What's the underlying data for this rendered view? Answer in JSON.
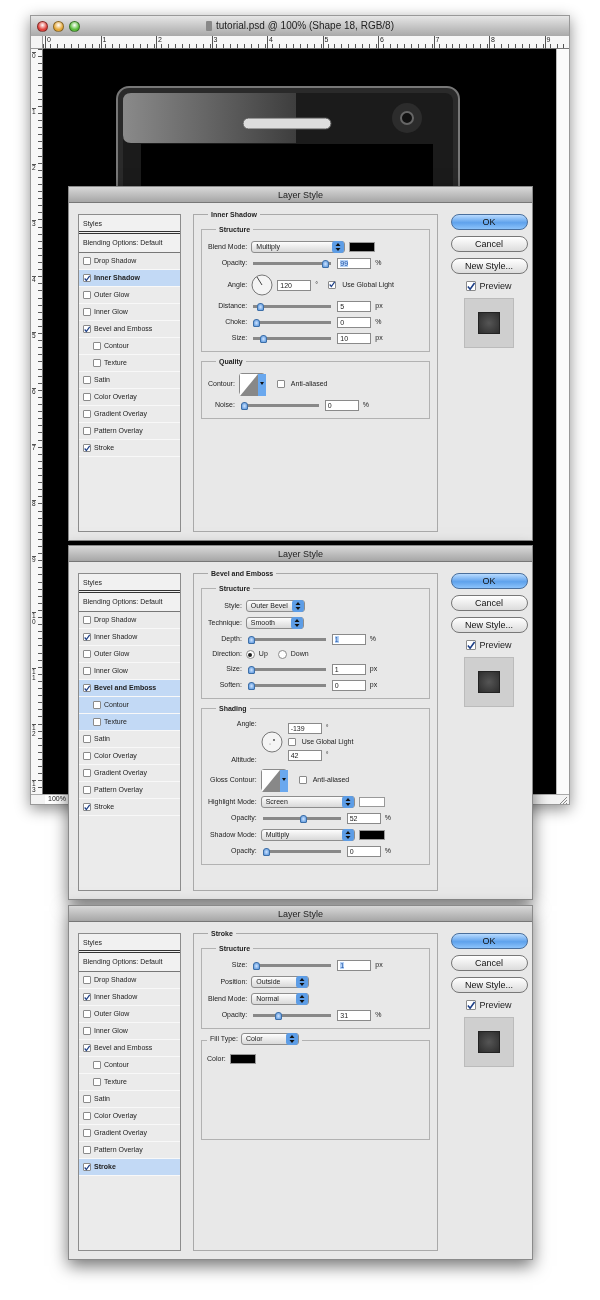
{
  "document_window": {
    "title": "tutorial.psd @ 100% (Shape 18, RGB/8)",
    "top_ruler": [
      "0",
      "1",
      "2",
      "3",
      "4",
      "5",
      "6",
      "7",
      "8",
      "9"
    ],
    "left_ruler": [
      "0",
      "1",
      "2",
      "3",
      "4",
      "5",
      "6",
      "7",
      "8",
      "9",
      "10",
      "11",
      "12",
      "13"
    ],
    "zoom": "100%"
  },
  "dialogs": [
    {
      "title": "Layer Style",
      "styles_header": "Styles",
      "blending_options": "Blending Options: Default",
      "styles": [
        {
          "label": "Drop Shadow",
          "checked": false,
          "selected": false
        },
        {
          "label": "Inner Shadow",
          "checked": true,
          "selected": true
        },
        {
          "label": "Outer Glow",
          "checked": false,
          "selected": false
        },
        {
          "label": "Inner Glow",
          "checked": false,
          "selected": false
        },
        {
          "label": "Bevel and Emboss",
          "checked": true,
          "selected": false,
          "children": [
            {
              "label": "Contour",
              "checked": false,
              "selected": false
            },
            {
              "label": "Texture",
              "checked": false,
              "selected": false
            }
          ]
        },
        {
          "label": "Satin",
          "checked": false,
          "selected": false
        },
        {
          "label": "Color Overlay",
          "checked": false,
          "selected": false
        },
        {
          "label": "Gradient Overlay",
          "checked": false,
          "selected": false
        },
        {
          "label": "Pattern Overlay",
          "checked": false,
          "selected": false
        },
        {
          "label": "Stroke",
          "checked": true,
          "selected": false
        }
      ],
      "panel": {
        "title": "Inner Shadow",
        "sections": [
          {
            "title": "Structure",
            "rows": [
              {
                "kind": "select",
                "label": "Blend Mode:",
                "value": "Multiply",
                "color": "#000000"
              },
              {
                "kind": "slider",
                "label": "Opacity:",
                "level": 0.97,
                "value": "99",
                "unit": "%",
                "focused": true
              },
              {
                "kind": "angle",
                "label": "Angle:",
                "value": "120",
                "unit": "°",
                "checkbox": {
                  "label": "Use Global Light",
                  "checked": true
                }
              },
              {
                "kind": "slider",
                "label": "Distance:",
                "level": 0.05,
                "value": "5",
                "unit": "px",
                "focused": false
              },
              {
                "kind": "slider",
                "label": "Choke:",
                "level": 0,
                "value": "0",
                "unit": "%",
                "focused": false
              },
              {
                "kind": "slider",
                "label": "Size:",
                "level": 0.1,
                "value": "10",
                "unit": "px",
                "focused": false
              }
            ]
          },
          {
            "title": "Quality",
            "rows": [
              {
                "kind": "contour",
                "label": "Contour:",
                "checkbox": {
                  "label": "Anti-aliased",
                  "checked": false
                }
              },
              {
                "kind": "slider",
                "label": "Noise:",
                "level": 0,
                "value": "0",
                "unit": "%",
                "focused": false
              }
            ]
          }
        ]
      },
      "buttons": [
        {
          "label": "OK",
          "kind": "default"
        },
        {
          "label": "Cancel",
          "kind": "normal"
        },
        {
          "label": "New Style...",
          "kind": "normal"
        }
      ],
      "preview": {
        "label": "Preview",
        "checked": true
      }
    },
    {
      "title": "Layer Style",
      "styles_header": "Styles",
      "blending_options": "Blending Options: Default",
      "styles": [
        {
          "label": "Drop Shadow",
          "checked": false,
          "selected": false
        },
        {
          "label": "Inner Shadow",
          "checked": true,
          "selected": false
        },
        {
          "label": "Outer Glow",
          "checked": false,
          "selected": false
        },
        {
          "label": "Inner Glow",
          "checked": false,
          "selected": false
        },
        {
          "label": "Bevel and Emboss",
          "checked": true,
          "selected": true,
          "children": [
            {
              "label": "Contour",
              "checked": false,
              "selected": true
            },
            {
              "label": "Texture",
              "checked": false,
              "selected": true
            }
          ]
        },
        {
          "label": "Satin",
          "checked": false,
          "selected": false
        },
        {
          "label": "Color Overlay",
          "checked": false,
          "selected": false
        },
        {
          "label": "Gradient Overlay",
          "checked": false,
          "selected": false
        },
        {
          "label": "Pattern Overlay",
          "checked": false,
          "selected": false
        },
        {
          "label": "Stroke",
          "checked": true,
          "selected": false
        }
      ],
      "panel": {
        "title": "Bevel and Emboss",
        "sections": [
          {
            "title": "Structure",
            "rows": [
              {
                "kind": "select",
                "label": "Style:",
                "value": "Outer Bevel"
              },
              {
                "kind": "select",
                "label": "Technique:",
                "value": "Smooth"
              },
              {
                "kind": "slider",
                "label": "Depth:",
                "level": 0,
                "value": "1",
                "unit": "%",
                "focused": true
              },
              {
                "kind": "radio",
                "label": "Direction:",
                "options": [
                  {
                    "label": "Up",
                    "selected": true
                  },
                  {
                    "label": "Down",
                    "selected": false
                  }
                ]
              },
              {
                "kind": "slider",
                "label": "Size:",
                "level": 0,
                "value": "1",
                "unit": "px",
                "focused": false
              },
              {
                "kind": "slider",
                "label": "Soften:",
                "level": 0,
                "value": "0",
                "unit": "px",
                "focused": false
              }
            ]
          },
          {
            "title": "Shading",
            "rows": [
              {
                "kind": "angle_altitude",
                "label": "Angle:",
                "value": "-139",
                "unit": "°",
                "checkbox": {
                  "label": "Use Global Light",
                  "checked": false
                },
                "altitude_label": "Altitude:",
                "altitude_value": "42",
                "altitude_unit": "°"
              },
              {
                "kind": "contour",
                "label": "Gloss Contour:",
                "checkbox": {
                  "label": "Anti-aliased",
                  "checked": false
                }
              },
              {
                "kind": "select",
                "label": "Highlight Mode:",
                "value": "Screen",
                "color": "#ffffff"
              },
              {
                "kind": "slider",
                "label": "Opacity:",
                "level": 0.52,
                "value": "52",
                "unit": "%",
                "focused": false
              },
              {
                "kind": "select",
                "label": "Shadow Mode:",
                "value": "Multiply",
                "color": "#000000"
              },
              {
                "kind": "slider",
                "label": "Opacity:",
                "level": 0,
                "value": "0",
                "unit": "%",
                "focused": false
              }
            ]
          }
        ]
      },
      "buttons": [
        {
          "label": "OK",
          "kind": "default"
        },
        {
          "label": "Cancel",
          "kind": "normal"
        },
        {
          "label": "New Style...",
          "kind": "normal"
        }
      ],
      "preview": {
        "label": "Preview",
        "checked": true
      }
    },
    {
      "title": "Layer Style",
      "styles_header": "Styles",
      "blending_options": "Blending Options: Default",
      "styles": [
        {
          "label": "Drop Shadow",
          "checked": false,
          "selected": false
        },
        {
          "label": "Inner Shadow",
          "checked": true,
          "selected": false
        },
        {
          "label": "Outer Glow",
          "checked": false,
          "selected": false
        },
        {
          "label": "Inner Glow",
          "checked": false,
          "selected": false
        },
        {
          "label": "Bevel and Emboss",
          "checked": true,
          "selected": false,
          "children": [
            {
              "label": "Contour",
              "checked": false,
              "selected": false
            },
            {
              "label": "Texture",
              "checked": false,
              "selected": false
            }
          ]
        },
        {
          "label": "Satin",
          "checked": false,
          "selected": false
        },
        {
          "label": "Color Overlay",
          "checked": false,
          "selected": false
        },
        {
          "label": "Gradient Overlay",
          "checked": false,
          "selected": false
        },
        {
          "label": "Pattern Overlay",
          "checked": false,
          "selected": false
        },
        {
          "label": "Stroke",
          "checked": true,
          "selected": true
        }
      ],
      "panel": {
        "title": "Stroke",
        "sections": [
          {
            "title": "Structure",
            "rows": [
              {
                "kind": "slider",
                "label": "Size:",
                "level": 0,
                "value": "1",
                "unit": "px",
                "focused": true
              },
              {
                "kind": "select",
                "label": "Position:",
                "value": "Outside"
              },
              {
                "kind": "select",
                "label": "Blend Mode:",
                "value": "Normal"
              },
              {
                "kind": "slider",
                "label": "Opacity:",
                "level": 0.3,
                "value": "31",
                "unit": "%",
                "focused": false
              }
            ]
          },
          {
            "legend": {
              "label": "Fill Type:",
              "value": "Color"
            },
            "rows": [
              {
                "kind": "color",
                "label": "Color:",
                "color": "#000000"
              }
            ]
          }
        ]
      },
      "buttons": [
        {
          "label": "OK",
          "kind": "default"
        },
        {
          "label": "Cancel",
          "kind": "normal"
        },
        {
          "label": "New Style...",
          "kind": "normal"
        }
      ],
      "preview": {
        "label": "Preview",
        "checked": true
      }
    }
  ]
}
